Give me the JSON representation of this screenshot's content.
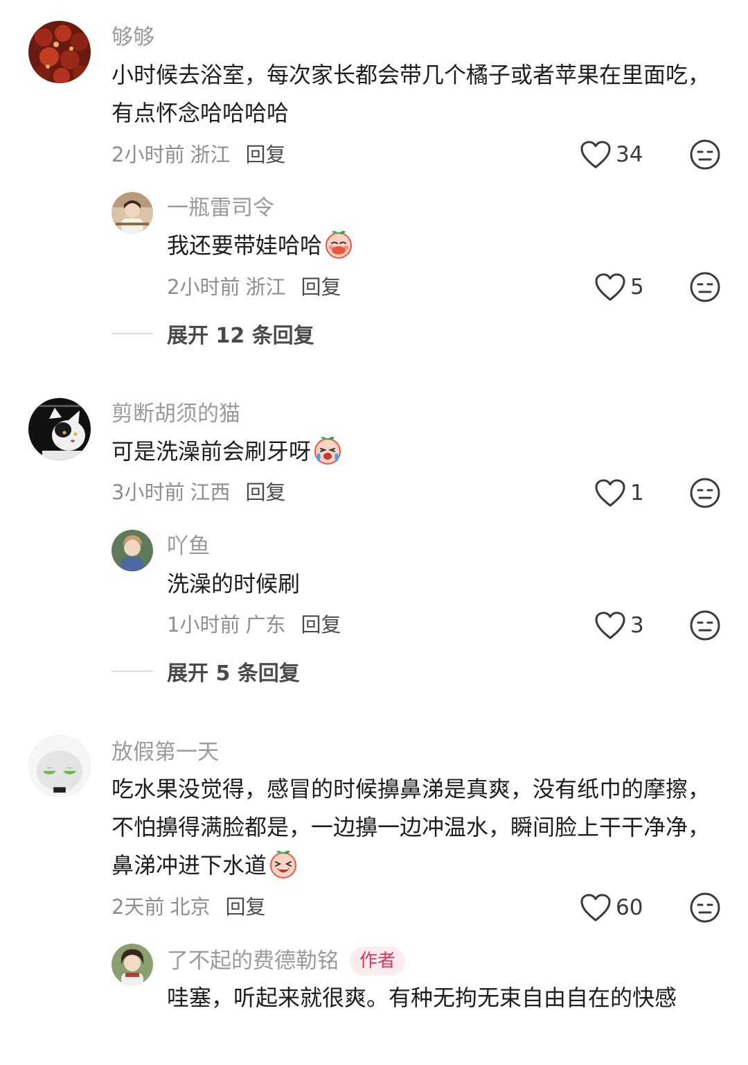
{
  "comments": [
    {
      "username": "够够",
      "text": "小时候去浴室，每次家长都会带几个橘子或者苹果在里面吃，有点怀念哈哈哈哈",
      "time": "2小时前",
      "location": "浙江",
      "reply_label": "回复",
      "likes": "34",
      "replies": [
        {
          "username": "一瓶雷司令",
          "text": "我还要带娃哈哈",
          "emoji": "blush-peach-emoji",
          "time": "2小时前",
          "location": "浙江",
          "reply_label": "回复",
          "likes": "5"
        }
      ],
      "expand_label": "展开 12 条回复"
    },
    {
      "username": "剪断胡须的猫",
      "text": "可是洗澡前会刷牙呀",
      "emoji": "crying-peach-emoji",
      "time": "3小时前",
      "location": "江西",
      "reply_label": "回复",
      "likes": "1",
      "replies": [
        {
          "username": "吖鱼",
          "text": "洗澡的时候刷",
          "time": "1小时前",
          "location": "广东",
          "reply_label": "回复",
          "likes": "3"
        }
      ],
      "expand_label": "展开 5 条回复"
    },
    {
      "username": "放假第一天",
      "text": "吃水果没觉得，感冒的时候擤鼻涕是真爽，没有纸巾的摩擦，不怕擤得满脸都是，一边擤一边冲温水，瞬间脸上干干净净，鼻涕冲进下水道",
      "emoji": "laughing-peach-emoji",
      "time": "2天前",
      "location": "北京",
      "reply_label": "回复",
      "likes": "60",
      "replies": [
        {
          "username": "了不起的费德勒铭",
          "badge": "作者",
          "text": "哇塞，听起来就很爽。有种无拘无束自由自在的快感"
        }
      ]
    }
  ],
  "colors": {
    "username": "#9a9a9a",
    "text": "#1d1d1d",
    "meta": "#8e8e8e",
    "author_badge_text": "#e0355a",
    "author_badge_bg": "#fdecef"
  }
}
